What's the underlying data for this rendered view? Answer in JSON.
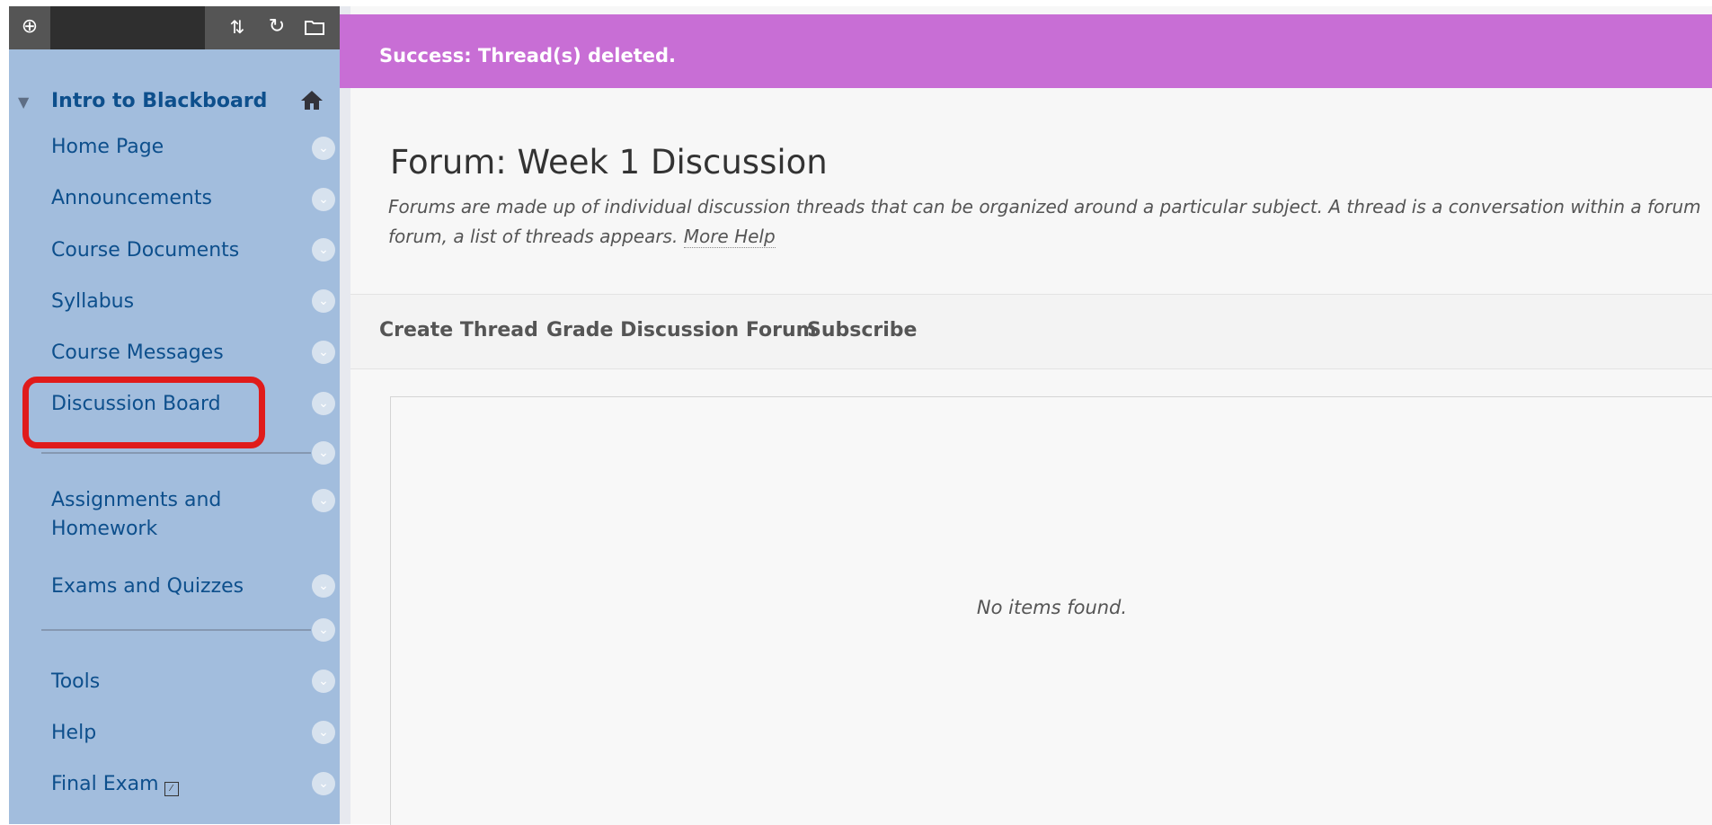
{
  "sidebar": {
    "course_title": "Intro to Blackboard",
    "items": [
      {
        "label": "Home Page"
      },
      {
        "label": "Announcements"
      },
      {
        "label": "Course Documents"
      },
      {
        "label": "Syllabus"
      },
      {
        "label": "Course Messages"
      },
      {
        "label": "Discussion Board"
      },
      {
        "label": "Assignments and Homework"
      },
      {
        "label": "Exams and Quizzes"
      },
      {
        "label": "Tools"
      },
      {
        "label": "Help"
      },
      {
        "label": "Final Exam"
      }
    ],
    "highlight_color": "#e01b1b",
    "background": "#a2bddd"
  },
  "icons": {
    "add": "plus-circle",
    "sort": "up-down-arrows",
    "refresh": "refresh",
    "folder": "folder",
    "home": "home",
    "chevron": "chevron-down",
    "collapse": "caret-down"
  },
  "banner": {
    "message": "Success: Thread(s) deleted.",
    "color": "#c86ed5"
  },
  "forum": {
    "title": "Forum: Week 1 Discussion",
    "description": "Forums are made up of individual discussion threads that can be organized around a particular subject. A thread is a conversation within a forum",
    "description_cont": "forum, a list of threads appears.",
    "more_help": "More Help"
  },
  "actions": {
    "create_thread": "Create Thread",
    "grade_forum": "Grade Discussion Forum",
    "subscribe": "Subscribe"
  },
  "content": {
    "empty_message": "No items found."
  }
}
